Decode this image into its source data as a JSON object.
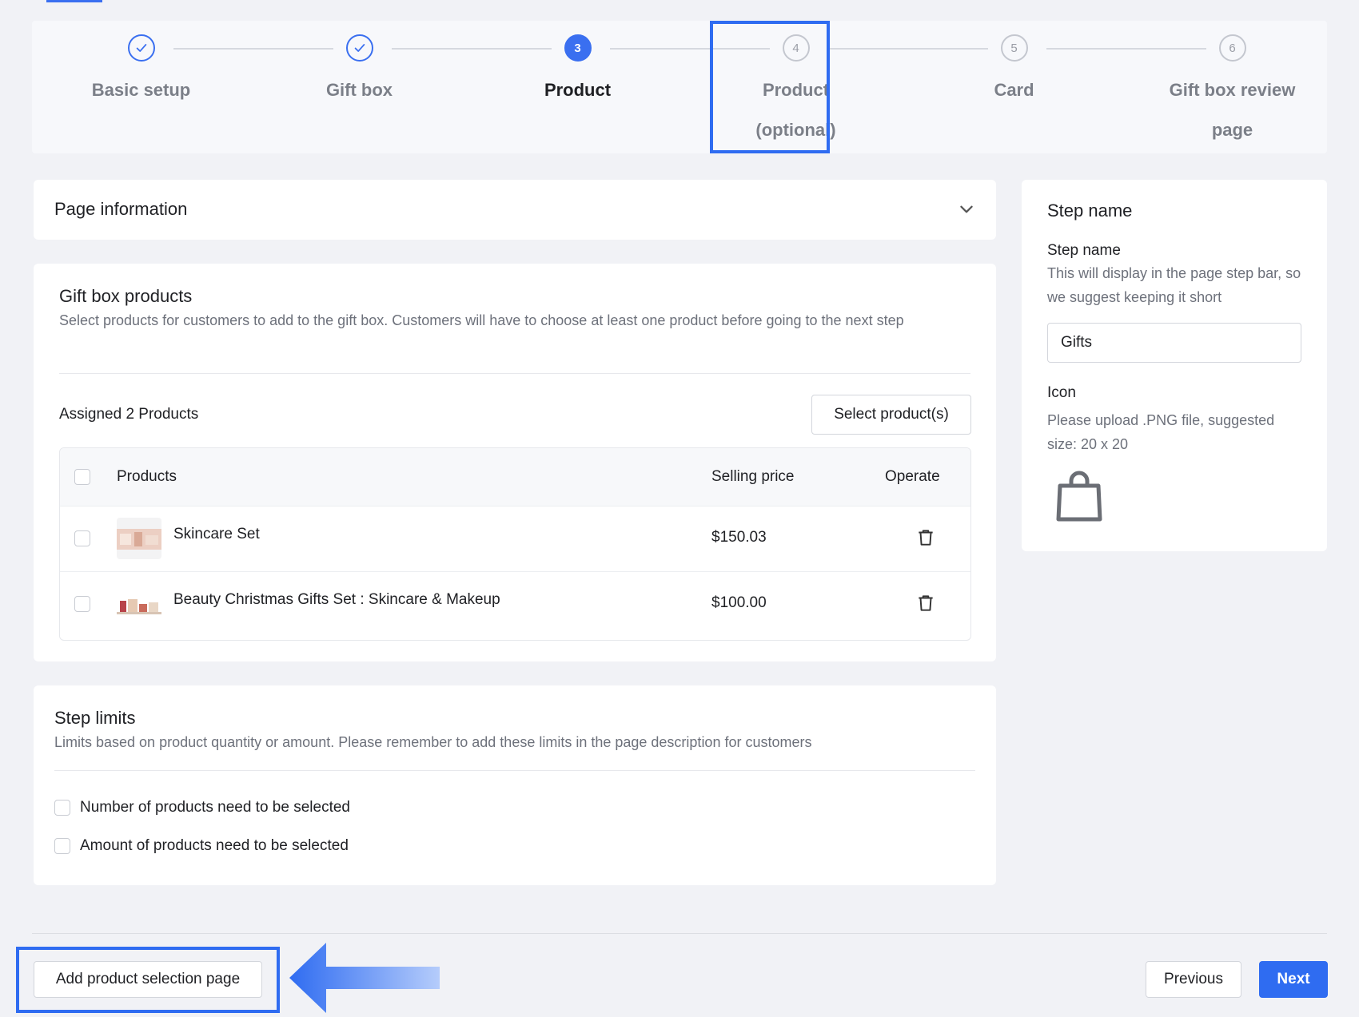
{
  "steps": [
    {
      "number": "1",
      "label": "Basic setup",
      "state": "done"
    },
    {
      "number": "2",
      "label": "Gift box",
      "state": "done"
    },
    {
      "number": "3",
      "label": "Product",
      "state": "active"
    },
    {
      "number": "4",
      "label_line1": "Product",
      "label_line2": "(optional)",
      "state": "pending"
    },
    {
      "number": "5",
      "label": "Card",
      "state": "pending"
    },
    {
      "number": "6",
      "label_line1": "Gift box review",
      "label_line2": "page",
      "state": "pending"
    }
  ],
  "page_information": {
    "title": "Page information",
    "chevron_icon": "chevron-down-icon"
  },
  "gift_box_products": {
    "title": "Gift box products",
    "description": "Select products for customers to add to the gift box. Customers will have to choose at least one product before going to the next step",
    "assigned_text": "Assigned 2 Products",
    "select_button": "Select product(s)",
    "columns": {
      "products": "Products",
      "selling_price": "Selling price",
      "operate": "Operate"
    },
    "rows": [
      {
        "name": "Skincare Set",
        "price": "$150.03"
      },
      {
        "name": "Beauty Christmas Gifts Set : Skincare & Makeup",
        "price": "$100.00"
      }
    ]
  },
  "step_limits": {
    "title": "Step limits",
    "description": "Limits based on product quantity or amount. Please remember to add these limits in the page description for customers",
    "options": [
      "Number of products need to be selected",
      "Amount of products need to be selected"
    ]
  },
  "sidebar": {
    "title": "Step name",
    "step_name_label": "Step name",
    "step_name_help": "This will display in the page step bar, so we suggest keeping it short",
    "step_name_value": "Gifts",
    "icon_label": "Icon",
    "icon_help": "Please upload .PNG file, suggested size: 20 x 20",
    "icon_preview": "shopping-bag-icon"
  },
  "footer": {
    "add_page_button": "Add product selection page",
    "previous_button": "Previous",
    "next_button": "Next"
  },
  "colors": {
    "accent": "#2f6cf1",
    "page_bg": "#f1f2f6"
  }
}
